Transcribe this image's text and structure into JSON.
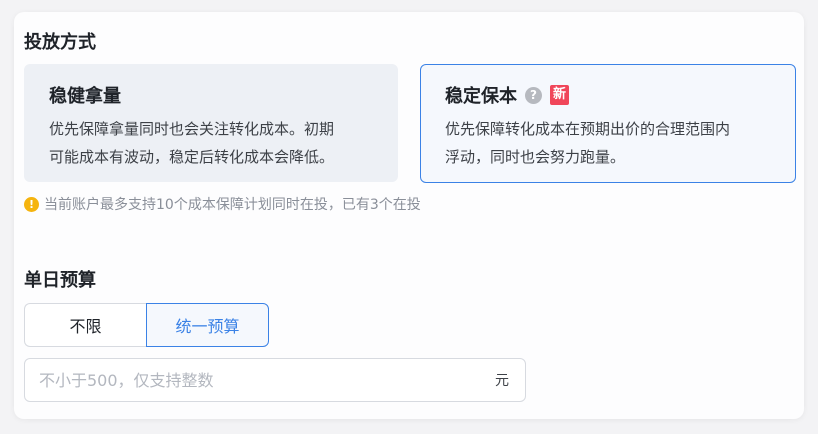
{
  "placement": {
    "section_title": "投放方式",
    "options": [
      {
        "title": "稳健拿量",
        "description_lines": [
          "优先保障拿量同时也会关注转化成本。初期",
          "可能成本有波动，稳定后转化成本会降低。"
        ]
      },
      {
        "title": "稳定保本",
        "help_icon": "?",
        "badge": "新",
        "description_lines": [
          "优先保障转化成本在预期出价的合理范围内",
          "浮动，同时也会努力跑量。"
        ]
      }
    ],
    "notice_icon": "!",
    "notice": "当前账户最多支持10个成本保障计划同时在投，已有3个在投"
  },
  "budget": {
    "section_title": "单日预算",
    "segments": [
      "不限",
      "统一预算"
    ],
    "selected_segment": "统一预算",
    "input_value": "",
    "input_placeholder": "不小于500，仅支持整数",
    "unit": "元"
  },
  "colors": {
    "accent": "#3b82e6",
    "badge": "#f0465a",
    "warning": "#f5b40f"
  }
}
